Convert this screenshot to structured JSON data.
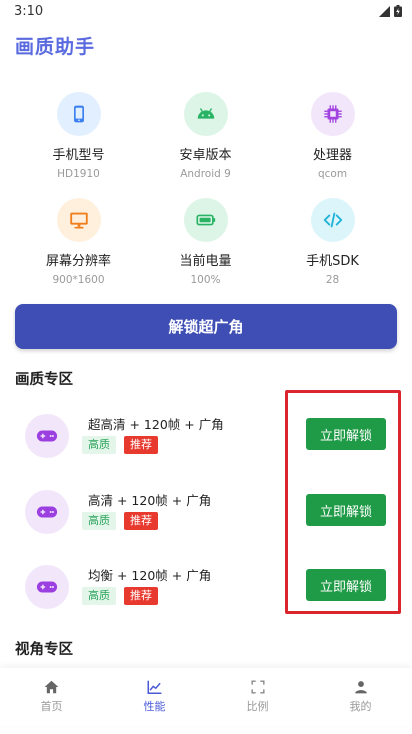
{
  "status": {
    "time": "3:10"
  },
  "app": {
    "title": "画质助手"
  },
  "device_info": [
    {
      "label": "手机型号",
      "value": "HD1910",
      "icon": "phone-icon",
      "bg": "#e2efff",
      "fg": "#3b7ff0"
    },
    {
      "label": "安卓版本",
      "value": "Android 9",
      "icon": "android-icon",
      "bg": "#ddf5e7",
      "fg": "#28b464"
    },
    {
      "label": "处理器",
      "value": "qcom",
      "icon": "cpu-icon",
      "bg": "#f2e6fb",
      "fg": "#a245e0"
    },
    {
      "label": "屏幕分辨率",
      "value": "900*1600",
      "icon": "monitor-icon",
      "bg": "#fff0dd",
      "fg": "#f07e1a"
    },
    {
      "label": "当前电量",
      "value": "100%",
      "icon": "battery-icon",
      "bg": "#ddf5e7",
      "fg": "#28b464"
    },
    {
      "label": "手机SDK",
      "value": "28",
      "icon": "code-icon",
      "bg": "#dcf5fb",
      "fg": "#1fb3d6"
    }
  ],
  "main_button": {
    "label": "解锁超广角"
  },
  "quality_section": {
    "title": "画质专区",
    "items": [
      {
        "name": "超高清 + 120帧 + 广角",
        "tag_quality": "高质",
        "tag_recommend": "推荐",
        "button": "立即解锁"
      },
      {
        "name": "高清 + 120帧 + 广角",
        "tag_quality": "高质",
        "tag_recommend": "推荐",
        "button": "立即解锁"
      },
      {
        "name": "均衡 + 120帧 + 广角",
        "tag_quality": "高质",
        "tag_recommend": "推荐",
        "button": "立即解锁"
      }
    ]
  },
  "view_section": {
    "title": "视角专区"
  },
  "nav": [
    {
      "label": "首页",
      "icon": "home-icon",
      "active": false
    },
    {
      "label": "性能",
      "icon": "chart-icon",
      "active": true
    },
    {
      "label": "比例",
      "icon": "fullscreen-icon",
      "active": false
    },
    {
      "label": "我的",
      "icon": "user-icon",
      "active": false
    }
  ],
  "colors": {
    "accent": "#3f4eb4",
    "unlock_green": "#1f9a46",
    "title_blue": "#5a6adf",
    "highlight_red": "#d9252b"
  }
}
